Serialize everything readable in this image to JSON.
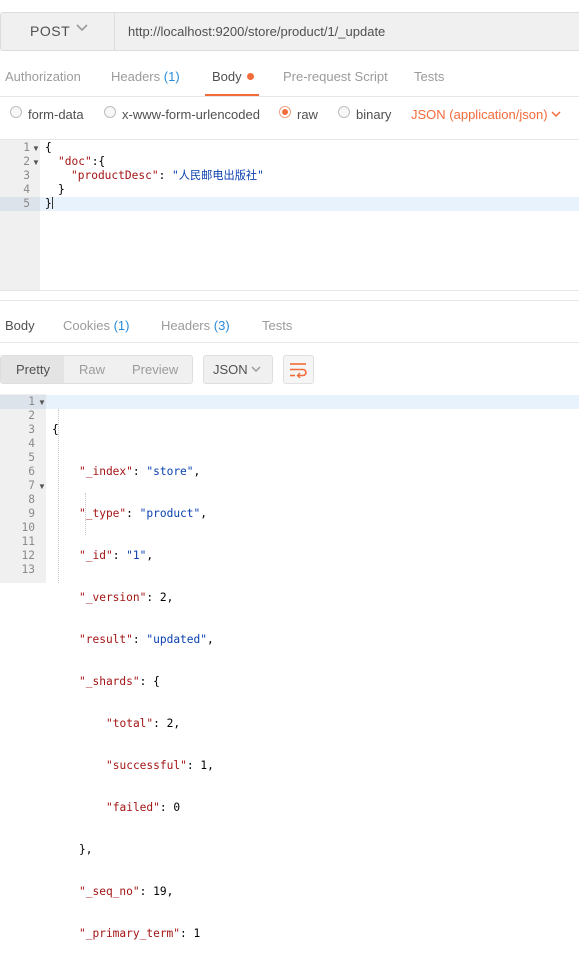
{
  "request": {
    "method": "POST",
    "url": "http://localhost:9200/store/product/1/_update",
    "tabs": {
      "authorization": "Authorization",
      "headers": "Headers",
      "headers_count": "(1)",
      "body": "Body",
      "prerequest": "Pre-request Script",
      "tests": "Tests"
    },
    "body_types": {
      "form_data": "form-data",
      "urlencoded": "x-www-form-urlencoded",
      "raw": "raw",
      "binary": "binary",
      "selected": "raw",
      "content_type": "JSON (application/json)"
    },
    "editor_lines": [
      "1",
      "2",
      "3",
      "4",
      "5"
    ],
    "editor": {
      "l1": "{",
      "l2_key": "\"doc\"",
      "l2_rest": ":{",
      "l3_key": "\"productDesc\"",
      "l3_colon": ": ",
      "l3_val": "\"人民邮电出版社\"",
      "l4": "}",
      "l5": "}"
    }
  },
  "response": {
    "tabs": {
      "body": "Body",
      "cookies": "Cookies",
      "cookies_count": "(1)",
      "headers": "Headers",
      "headers_count": "(3)",
      "tests": "Tests"
    },
    "view_modes": {
      "pretty": "Pretty",
      "raw": "Raw",
      "preview": "Preview",
      "format": "JSON"
    },
    "lines": [
      "1",
      "2",
      "3",
      "4",
      "5",
      "6",
      "7",
      "8",
      "9",
      "10",
      "11",
      "12",
      "13"
    ],
    "json": {
      "open": "{",
      "index_key": "\"_index\"",
      "index_val": "\"store\"",
      "type_key": "\"_type\"",
      "type_val": "\"product\"",
      "id_key": "\"_id\"",
      "id_val": "\"1\"",
      "version_key": "\"_version\"",
      "version_val": "2",
      "result_key": "\"result\"",
      "result_val": "\"updated\"",
      "shards_key": "\"_shards\"",
      "shards_open": "{",
      "total_key": "\"total\"",
      "total_val": "2",
      "successful_key": "\"successful\"",
      "successful_val": "1",
      "failed_key": "\"failed\"",
      "failed_val": "0",
      "shards_close": "},",
      "seq_key": "\"_seq_no\"",
      "seq_val": "19",
      "primary_key": "\"_primary_term\"",
      "primary_val": "1"
    }
  },
  "colors": {
    "accent": "#f26b3a",
    "count_blue": "#2a8bd9",
    "json_key": "#a31515",
    "json_string": "#0b40b0"
  }
}
